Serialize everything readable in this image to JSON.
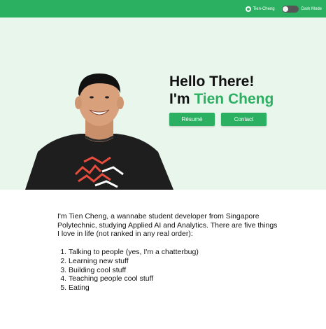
{
  "colors": {
    "accent": "#2bb061",
    "hero_bg": "#e8f6ec"
  },
  "topbar": {
    "github_label": "Tien-Cheng",
    "github_icon": "github-icon",
    "dark_mode_label": "Dark Mode",
    "dark_mode_on": false
  },
  "hero": {
    "greeting": "Hello There!",
    "im_prefix": "I'm ",
    "name": "Tien Cheng",
    "resume_label": "Résumé",
    "contact_label": "Contact"
  },
  "about": {
    "intro": "I'm Tien Cheng, a wannabe student developer from Singapore Polytechnic, studying Applied AI and Analytics. There are five things I love in life (not ranked in any real order):",
    "items": [
      "Talking to people (yes, I'm a chatterbug)",
      "Learning new stuff",
      "Building cool stuff",
      "Teaching people cool stuff",
      "Eating"
    ]
  }
}
